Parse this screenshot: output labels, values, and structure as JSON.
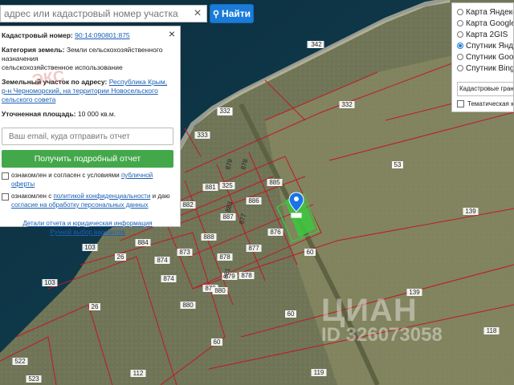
{
  "search": {
    "placeholder": "адрес или кадастровый номер участка",
    "clear_icon": "close-icon",
    "button_label": "Найти",
    "button_icon": "search-icon"
  },
  "info": {
    "cad_label": "Кадастровый номер:",
    "cad_value": "90:14:090801:875",
    "category_label": "Категория земель:",
    "category_value": "Земли сельскохозяйственного назначения",
    "category_use": "сельскохозяйственное использование",
    "address_label": "Земельный участок по адресу:",
    "address_value": "Республика Крым, р-н Черноморский, на территории Новосельского сельского совета",
    "area_label": "Уточненная площадь:",
    "area_value": "10 000 кв.м.",
    "stamp_text": "ЭКС",
    "email_placeholder": "Ваш email, куда отправить отчет",
    "report_button": "Получить подробный отчет",
    "consent1_text": "ознакомлен и согласен с условиями",
    "consent1_link": "публичной оферты",
    "consent2_text": "ознакомлен с",
    "consent2_link": "политикой конфиденциальности",
    "consent2_tail": "и даю",
    "consent2_link2": "согласие на обработку персональных данных",
    "link_details": "Детали отчета и юридическая информация",
    "link_manual": "Ручной выбор вариантов"
  },
  "layers": {
    "options": [
      {
        "label": "Карта Яндекс",
        "selected": false
      },
      {
        "label": "Карта Google",
        "selected": false
      },
      {
        "label": "Карта 2GIS",
        "selected": false
      },
      {
        "label": "Спутник Яндекс",
        "selected": true
      },
      {
        "label": "Спутник Google",
        "selected": false
      },
      {
        "label": "Спутник Bing",
        "selected": false
      }
    ],
    "select_value": "Кадастровые границы",
    "check_label": "Тематическая карта"
  },
  "map": {
    "parcel_labels": [
      "885",
      "886",
      "887",
      "888",
      "881",
      "882",
      "884",
      "873",
      "874",
      "874",
      "879",
      "880",
      "876",
      "877",
      "878",
      "878",
      "879",
      "880",
      "332",
      "333",
      "342",
      "344",
      "325",
      "60",
      "60",
      "60",
      "26",
      "26",
      "103",
      "103",
      "522",
      "523",
      "112",
      "119",
      "118",
      "139",
      "139",
      "53",
      "332",
      "342"
    ],
    "cat_labels": [
      "879",
      "878",
      "877",
      "881",
      "883"
    ],
    "selected_color": "#3ec43e",
    "boundary_color": "#c0182a",
    "marker_icon": "map-pin-icon"
  },
  "watermark": {
    "brand": "ЦИАН",
    "id": "ID 326073058"
  }
}
